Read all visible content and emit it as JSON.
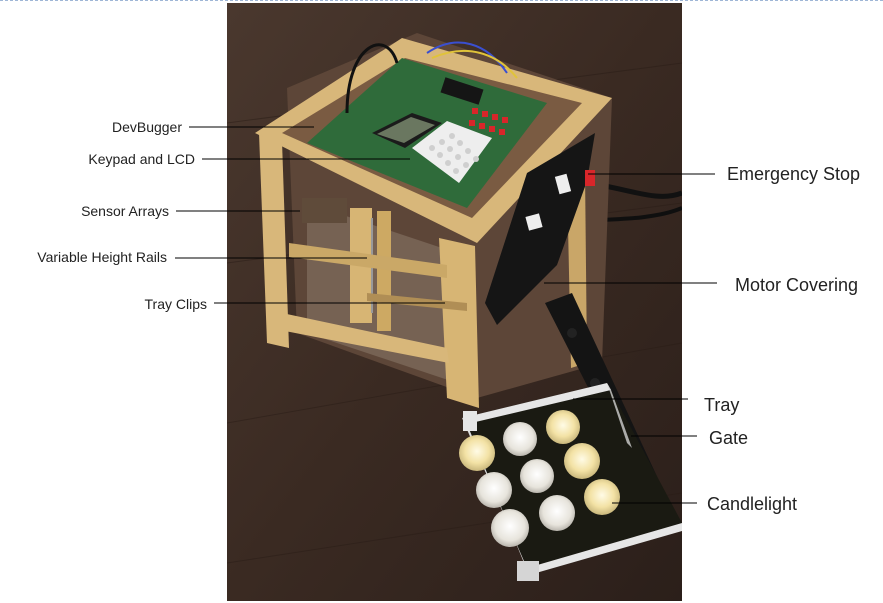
{
  "labels": {
    "devbugger": "DevBugger",
    "keypad_lcd": "Keypad and LCD",
    "sensor_arrays": "Sensor Arrays",
    "variable_height_rails": "Variable Height Rails",
    "tray_clips": "Tray Clips",
    "emergency_stop": "Emergency Stop",
    "motor_covering": "Motor Covering",
    "tray": "Tray",
    "gate": "Gate",
    "candlelight": "Candlelight"
  },
  "colors": {
    "floor": "#3a2a22",
    "wood": "#d8b77a",
    "pcb_green": "#2f6b3a",
    "panel_black": "#151515",
    "stop_red": "#d8262a",
    "candle_warm": "#f3e2a5"
  }
}
